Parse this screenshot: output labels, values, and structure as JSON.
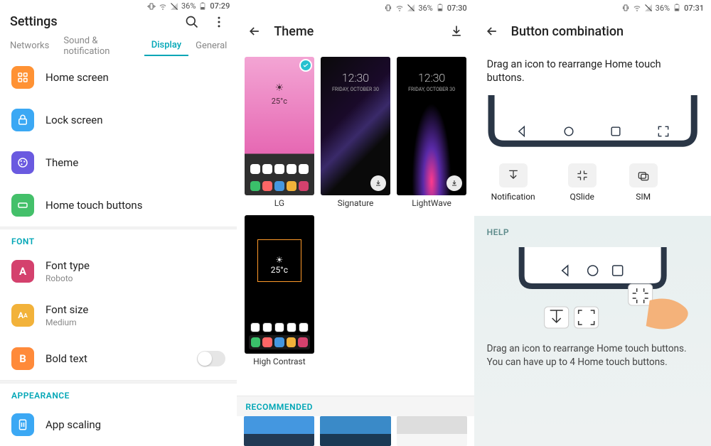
{
  "status": {
    "battery": "36%",
    "t1": "07:29",
    "t2": "07:30",
    "t3": "07:31"
  },
  "p1": {
    "title": "Settings",
    "tabs": [
      "Networks",
      "Sound & notification",
      "Display",
      "General"
    ],
    "activeTab": 2,
    "items": {
      "home": "Home screen",
      "lock": "Lock screen",
      "theme": "Theme",
      "touch": "Home touch buttons"
    },
    "font_label": "FONT",
    "fonttype": {
      "t": "Font type",
      "s": "Roboto"
    },
    "fontsize": {
      "t": "Font size",
      "s": "Medium"
    },
    "bold": "Bold text",
    "appearance_label": "APPEARANCE",
    "appscale": "App scaling"
  },
  "p2": {
    "title": "Theme",
    "themes": {
      "lg": {
        "name": "LG",
        "clock": "25°c"
      },
      "sig": {
        "name": "Signature",
        "clock": "12:30",
        "date": "FRIDAY, OCTOBER 30"
      },
      "lw": {
        "name": "LightWave",
        "clock": "12:30",
        "date": "FRIDAY, OCTOBER 30"
      },
      "hc": {
        "name": "High Contrast",
        "clock": "25°c"
      }
    },
    "recommended": "RECOMMENDED"
  },
  "p3": {
    "title": "Button combination",
    "instruct": "Drag an icon to rearrange Home touch buttons.",
    "extras": {
      "notif": "Notification",
      "qslide": "QSlide",
      "sim": "SIM"
    },
    "help_label": "HELP",
    "help_text": "Drag an icon to rearrange Home touch buttons. You can have up to 4 Home touch buttons."
  }
}
